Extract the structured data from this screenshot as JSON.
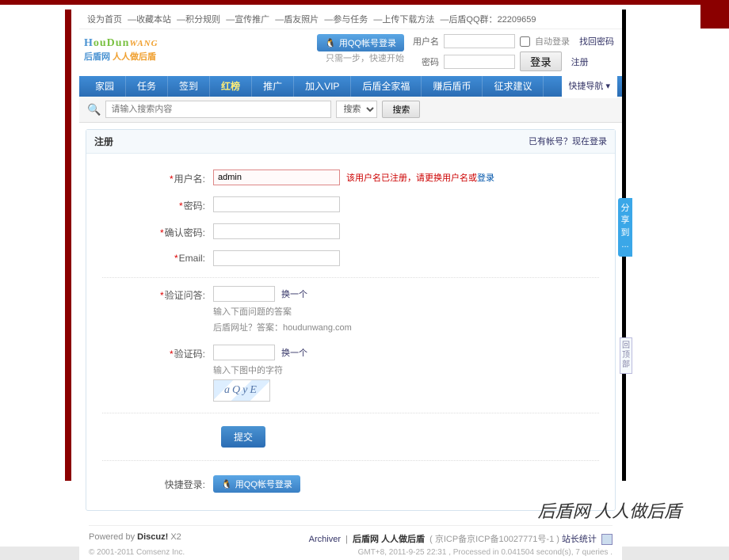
{
  "topbar": {
    "items": [
      "设为首页",
      "—收藏本站",
      "—积分规则",
      "—宣传推广",
      "—盾友照片",
      "—参与任务",
      "—上传下载方法",
      "—后盾QQ群："
    ],
    "qq_group": "22209659"
  },
  "logo": {
    "line1_h": "H",
    "line1_ou": "ouDun",
    "line1_wang": "WANG",
    "line2a": "后盾网",
    "line2b": " 人人做后盾"
  },
  "header": {
    "qq_login": "用QQ帐号登录",
    "qq_hint": "只需一步，快速开始",
    "user_label": "用户名",
    "pass_label": "密码",
    "auto_login": "自动登录",
    "forgot": "找回密码",
    "login_btn": "登录",
    "register": "注册"
  },
  "nav": {
    "items": [
      "家园",
      "任务",
      "签到",
      "红榜",
      "推广",
      "加入VIP",
      "后盾全家福",
      "赚后盾币",
      "征求建议"
    ],
    "active_index": 3,
    "quicknav": "快捷导航"
  },
  "search": {
    "placeholder": "请输入搜索内容",
    "select": "搜索",
    "btn": "搜索"
  },
  "panel": {
    "title": "注册",
    "has_account": "已有帐号？",
    "login_now": "现在登录"
  },
  "form": {
    "username_label": "用户名:",
    "username_value": "admin",
    "username_error_pre": "该用户名已注册，请更换用户名或",
    "username_error_login": "登录",
    "password_label": "密码:",
    "password2_label": "确认密码:",
    "email_label": "Email:",
    "question_label": "验证问答:",
    "question_change": "换一个",
    "question_hint1": "输入下面问题的答案",
    "question_hint2": "后盾网址？答案：houdunwang.com",
    "captcha_label": "验证码:",
    "captcha_change": "换一个",
    "captcha_hint": "输入下图中的字符",
    "captcha_text": "aQyE",
    "submit": "提交",
    "quick_login_label": "快捷登录:",
    "quick_login_btn": "用QQ帐号登录"
  },
  "footer": {
    "powered_pre": "Powered by ",
    "powered_link": "Discuz!",
    "powered_ver": " X2",
    "copyright": "© 2001-2011 Comsenz Inc.",
    "archiver": "Archiver",
    "site_name": "后盾网 人人做后盾",
    "icp": "( 京ICP备京ICP备10027771号-1 )",
    "stats": "站长统计",
    "gmt": "GMT+8, 2011-9-25 22:31 , Processed in 0.041504 second(s), 7 queries ."
  },
  "share_tab": "分享到 ...",
  "back_top": "回顶部",
  "caption": "后盾网 人人做后盾"
}
